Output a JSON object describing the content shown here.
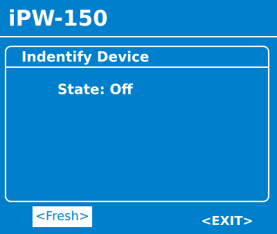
{
  "device": {
    "title": "iPW-150"
  },
  "panel": {
    "title": "Indentify Device",
    "state_text": "State: Off"
  },
  "softkeys": {
    "fresh_label": "<Fresh>",
    "exit_label": "<EXIT>"
  },
  "colors": {
    "background": "#0080cc",
    "foreground": "#ffffff",
    "highlight_text": "#0080cc"
  }
}
